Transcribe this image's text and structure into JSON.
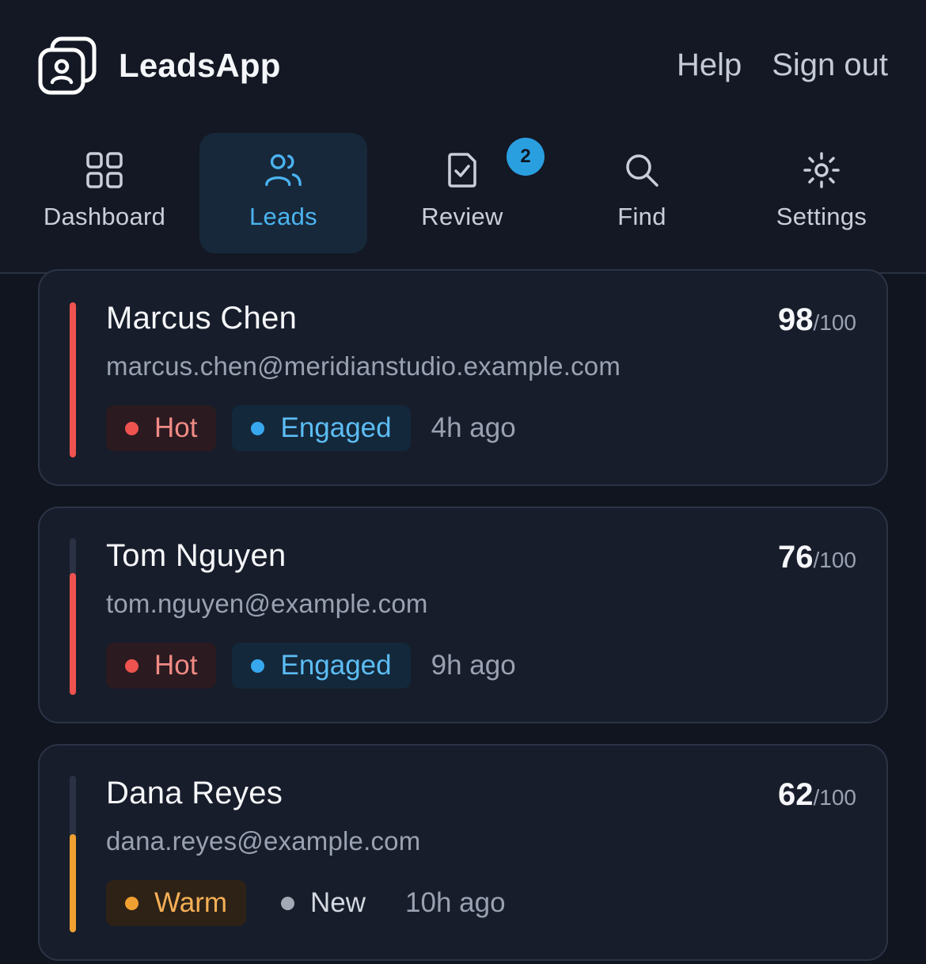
{
  "app": {
    "name": "LeadsApp"
  },
  "header": {
    "help_label": "Help",
    "signout_label": "Sign out"
  },
  "nav": {
    "tabs": [
      {
        "label": "Dashboard",
        "icon": "grid-icon",
        "active": false
      },
      {
        "label": "Leads",
        "icon": "users-icon",
        "active": true
      },
      {
        "label": "Review",
        "icon": "checklist-icon",
        "active": false,
        "badge": "2"
      },
      {
        "label": "Find",
        "icon": "search-icon",
        "active": false
      },
      {
        "label": "Settings",
        "icon": "sun-gear-icon",
        "active": false
      }
    ]
  },
  "leads": [
    {
      "name": "Marcus Chen",
      "email": "marcus.chen@meridianstudio.example.com",
      "score": "98",
      "score_max": "/100",
      "temperature": "Hot",
      "status": "Engaged",
      "time": "4h ago"
    },
    {
      "name": "Tom Nguyen",
      "email": "tom.nguyen@example.com",
      "score": "76",
      "score_max": "/100",
      "temperature": "Hot",
      "status": "Engaged",
      "time": "9h ago"
    },
    {
      "name": "Dana Reyes",
      "email": "dana.reyes@example.com",
      "score": "62",
      "score_max": "/100",
      "temperature": "Warm",
      "status": "New",
      "time": "10h ago"
    }
  ],
  "colors": {
    "accent": "#4bb3f0",
    "hot": "#ef5350",
    "warm": "#f0a030",
    "background": "#111520"
  }
}
